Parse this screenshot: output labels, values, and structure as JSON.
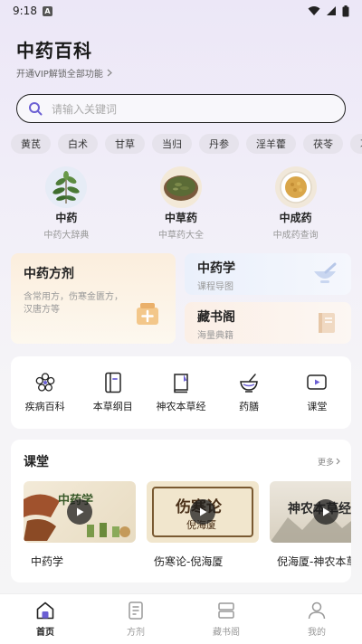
{
  "status": {
    "time": "9:18",
    "indicator": "A"
  },
  "header": {
    "title": "中药百科",
    "vip_text": "开通VIP解锁全部功能"
  },
  "search": {
    "placeholder": "请输入关键词"
  },
  "tags": [
    "黄芪",
    "白术",
    "甘草",
    "当归",
    "丹参",
    "淫羊藿",
    "茯苓",
    "葛根"
  ],
  "categories": [
    {
      "name": "中药",
      "sub": "中药大辞典"
    },
    {
      "name": "中草药",
      "sub": "中草药大全"
    },
    {
      "name": "中成药",
      "sub": "中成药查询"
    }
  ],
  "cards": {
    "formula": {
      "title": "中药方剂",
      "desc": "含常用方，伤寒金匮方，汉唐方等"
    },
    "study": {
      "title": "中药学",
      "sub": "课程导图"
    },
    "library": {
      "title": "藏书阁",
      "sub": "海量典籍"
    }
  },
  "tools": [
    "疾病百科",
    "本草纲目",
    "神农本草经",
    "药膳",
    "课堂"
  ],
  "course": {
    "title": "课堂",
    "more": "更多",
    "videos": [
      {
        "title": "中药学",
        "thumb_text": "中药学"
      },
      {
        "title": "伤寒论-倪海厦",
        "thumb_text": "伤寒论",
        "thumb_sub": "倪海厦"
      },
      {
        "title": "倪海厦-神农本草经",
        "thumb_text": "神农本草经"
      }
    ]
  },
  "tabbar": [
    "首页",
    "方剂",
    "藏书阁",
    "我的"
  ],
  "colors": {
    "accent": "#6b5fd3",
    "text": "#222222",
    "muted": "#999999"
  }
}
